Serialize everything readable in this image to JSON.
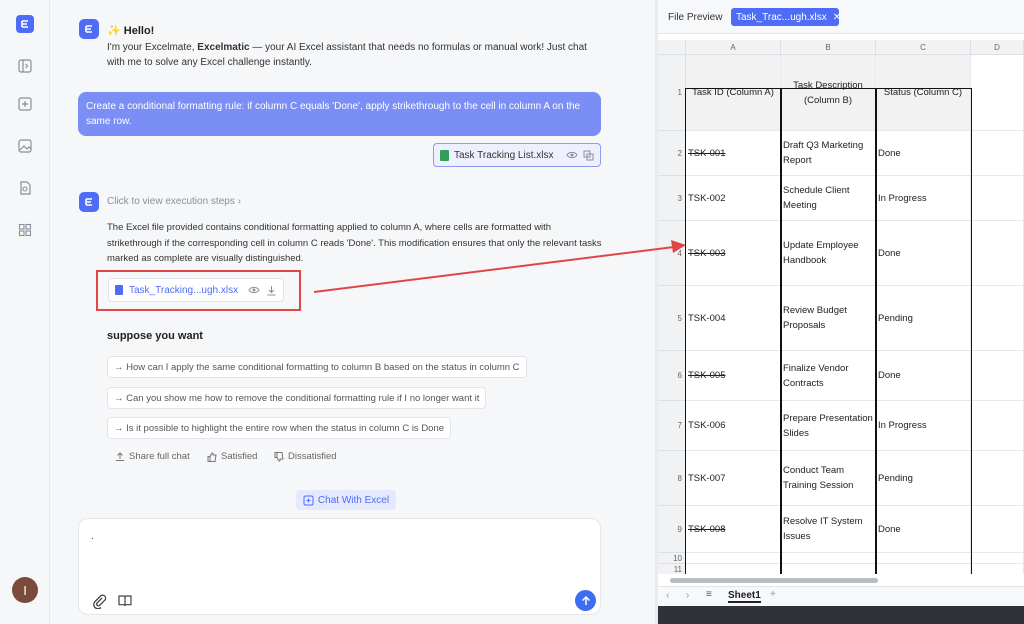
{
  "sidebar": {
    "avatar_letter": "I"
  },
  "chat": {
    "hello": "Hello!",
    "intro_prefix": "I'm your Excelmate, ",
    "intro_brand": "Excelmatic",
    "intro_suffix": " — your AI Excel assistant that needs no formulas or manual work! Just chat with me to solve any Excel challenge instantly.",
    "user_message": "Create a conditional formatting rule: if column C equals 'Done', apply strikethrough to the cell in column A on the same row.",
    "user_file": "Task Tracking List.xlsx",
    "exec_steps": "Click to view execution steps",
    "reply": "The Excel file provided contains conditional formatting applied to column A, where cells are formatted with strikethrough if the corresponding cell in column C reads 'Done'. This modification ensures that only the relevant tasks marked as complete are visually distinguished.",
    "result_file": "Task_Tracking...ugh.xlsx",
    "suppose_title": "suppose you want",
    "suggestions": [
      "→ How can I apply the same conditional formatting to column B based on the status in column C",
      "→ Can you show me how to remove the conditional formatting rule if I no longer want it",
      "→ Is it possible to highlight the entire row when the status in column C is Done"
    ],
    "share": "Share full chat",
    "satisfied": "Satisfied",
    "dissatisfied": "Dissatisfied",
    "chat_with_excel": "Chat With Excel",
    "input_value": "."
  },
  "preview": {
    "label": "File Preview",
    "tab": "Task_Trac...ugh.xlsx",
    "columns": [
      "A",
      "B",
      "C",
      "D"
    ],
    "row_numbers": [
      "1",
      "2",
      "3",
      "4",
      "5",
      "6",
      "7",
      "8",
      "9",
      "10",
      "11"
    ],
    "headers": [
      "Task ID (Column A)",
      "Task Description (Column B)",
      "Status (Column C)"
    ],
    "rows": [
      {
        "id": "TSK-001",
        "desc": "Draft Q3 Marketing Report",
        "status": "Done"
      },
      {
        "id": "TSK-002",
        "desc": "Schedule Client Meeting",
        "status": "In Progress"
      },
      {
        "id": "TSK-003",
        "desc": "Update Employee Handbook",
        "status": "Done"
      },
      {
        "id": "TSK-004",
        "desc": "Review Budget Proposals",
        "status": "Pending"
      },
      {
        "id": "TSK-005",
        "desc": "Finalize Vendor Contracts",
        "status": "Done"
      },
      {
        "id": "TSK-006",
        "desc": "Prepare Presentation Slides",
        "status": "In Progress"
      },
      {
        "id": "TSK-007",
        "desc": "Conduct Team Training Session",
        "status": "Pending"
      },
      {
        "id": "TSK-008",
        "desc": "Resolve IT System Issues",
        "status": "Done"
      }
    ],
    "sheet_tab": "Sheet1"
  },
  "colors": {
    "accent": "#4f6cf7",
    "annotation": "#e04646"
  }
}
